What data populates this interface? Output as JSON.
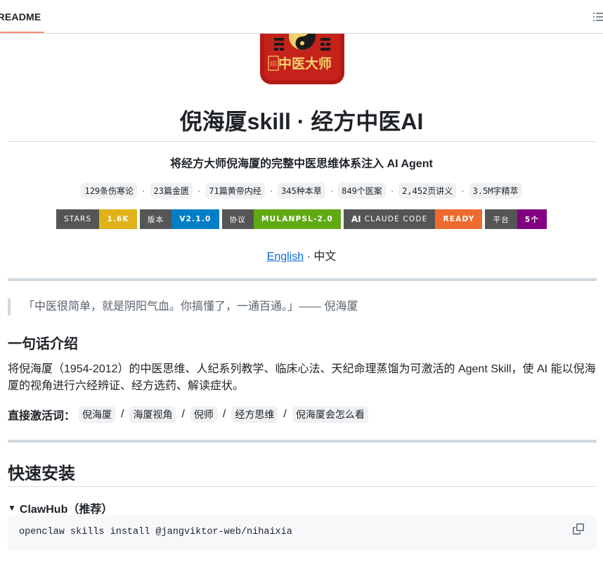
{
  "tabs": {
    "readme": "README"
  },
  "logo": {
    "text": "中医大师",
    "seal": "印"
  },
  "title": "倪海厦skill · 经方中医AI",
  "subtitle": "将经方大师倪海厦的完整中医思维体系注入 AI Agent",
  "stats": [
    "129条伤寒论",
    "23篇金匮",
    "71篇黄帝内经",
    "345种本草",
    "849个医案",
    "2,452页讲义",
    "3.5M字精萃"
  ],
  "stat_separator": "·",
  "badges": [
    {
      "label": "STARS",
      "value": "1.6K",
      "color": "#dfb317"
    },
    {
      "label": "版本",
      "value": "V2.1.0",
      "color": "#007ec6"
    },
    {
      "label": "协议",
      "value": "MULANPSL-2.0",
      "color": "#4c1"
    },
    {
      "label": "CLAUDE CODE",
      "value": "READY",
      "color": "#fe7d37",
      "icon": "AI"
    },
    {
      "label": "平台",
      "value": "5个",
      "color": "#800080"
    }
  ],
  "lang": {
    "english": "English",
    "sep": " · ",
    "chinese": "中文"
  },
  "quote": "「中医很简单，就是阴阳气血。你搞懂了，一通百通。」—— 倪海厦",
  "intro": {
    "heading": "一句话介绍",
    "body": "将倪海厦（1954-2012）的中医思维、人纪系列教学、临床心法、天纪命理蒸馏为可激活的 Agent Skill，使 AI 能以倪海厦的视角进行六经辨证、经方选药、解读症状。"
  },
  "triggers": {
    "label": "直接激活词：",
    "items": [
      "倪海厦",
      "海厦视角",
      "倪师",
      "经方思维",
      "倪海厦会怎么看"
    ],
    "sep": "/"
  },
  "install": {
    "heading": "快速安装",
    "summary": "ClawHub（推荐）",
    "summary_marker": "▼",
    "command": "openclaw skills install @jangviktor-web/nihaixia"
  }
}
